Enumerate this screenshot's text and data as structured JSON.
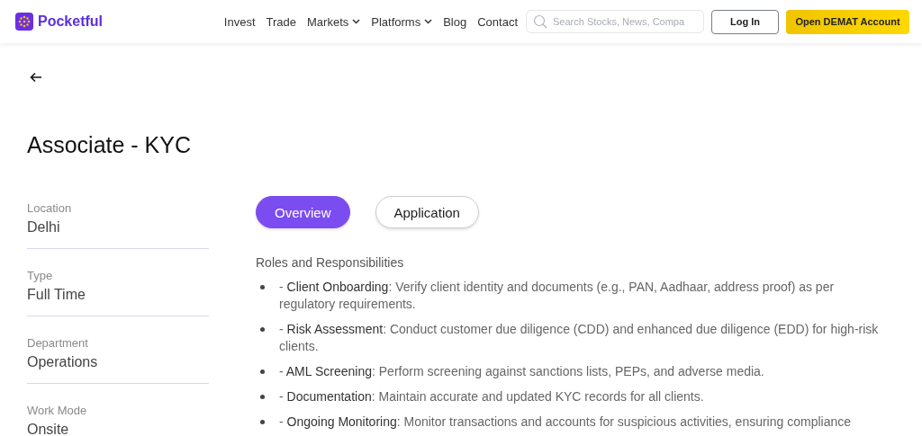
{
  "header": {
    "logo": "Pocketful",
    "nav": [
      {
        "label": "Invest",
        "dropdown": false
      },
      {
        "label": "Trade",
        "dropdown": false
      },
      {
        "label": "Markets",
        "dropdown": true
      },
      {
        "label": "Platforms",
        "dropdown": true
      },
      {
        "label": "Blog",
        "dropdown": false
      },
      {
        "label": "Contact",
        "dropdown": false
      }
    ],
    "search": {
      "placeholder": "Search Stocks, News, Compa"
    },
    "login": "Log In",
    "cta": "Open DEMAT Account"
  },
  "title": "Associate - KYC",
  "details": [
    {
      "label": "Location",
      "value": "Delhi"
    },
    {
      "label": "Type",
      "value": "Full Time"
    },
    {
      "label": "Department",
      "value": "Operations"
    },
    {
      "label": "Work Mode",
      "value": "Onsite"
    }
  ],
  "tabs": [
    {
      "label": "Overview",
      "selected": true
    },
    {
      "label": "Application",
      "selected": false
    }
  ],
  "section_title": "Roles and Responsibilities",
  "items": [
    "- **Client Onboarding**: Verify client identity and documents (e.g., PAN, Aadhaar, address proof) as per regulatory requirements.",
    "- **Risk Assessment**: Conduct customer due diligence (CDD) and enhanced due diligence (EDD) for high-risk clients.",
    "- **AML Screening**: Perform screening against sanctions lists, PEPs, and adverse media.",
    "- **Documentation**: Maintain accurate and updated KYC records for all clients.",
    "- **Ongoing Monitoring**: Monitor transactions and accounts for suspicious activities, ensuring compliance"
  ]
}
